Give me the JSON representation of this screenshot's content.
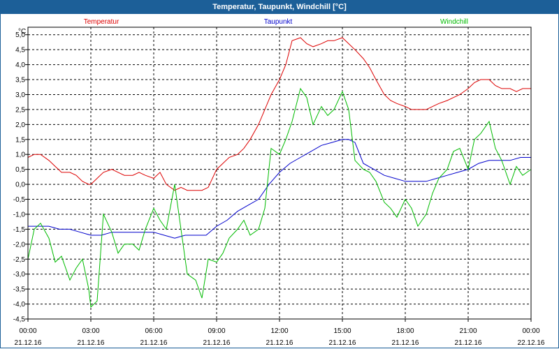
{
  "window": {
    "title": "Temperatur, Taupunkt, Windchill [°C]"
  },
  "chart_data": {
    "type": "line",
    "title": "Temperatur, Taupunkt, Windchill [°C]",
    "ylabel": "°C",
    "xlabel": "",
    "ylim": [
      -4.5,
      5.25
    ],
    "xlim_hours": [
      0,
      24
    ],
    "grid": true,
    "legend_position": "top",
    "y_ticks": [
      5.0,
      4.5,
      4.0,
      3.5,
      3.0,
      2.5,
      2.0,
      1.5,
      1.0,
      0.5,
      0.0,
      -0.5,
      -1.0,
      -1.5,
      -2.0,
      -2.5,
      -3.0,
      -3.5,
      -4.0,
      -4.5
    ],
    "y_tick_labels": [
      "5,0",
      "4,5",
      "4,0",
      "3,5",
      "3,0",
      "2,5",
      "2,0",
      "1,5",
      "1,0",
      "0,5",
      "0,0",
      "-0,5",
      "-1,0",
      "-1,5",
      "-2,0",
      "-2,5",
      "-3,0",
      "-3,5",
      "-4,0",
      "-4,5"
    ],
    "x_ticks": [
      {
        "hour": 0,
        "time": "00:00",
        "date": "21.12.16"
      },
      {
        "hour": 3,
        "time": "03:00",
        "date": "21.12.16"
      },
      {
        "hour": 6,
        "time": "06:00",
        "date": "21.12.16"
      },
      {
        "hour": 9,
        "time": "09:00",
        "date": "21.12.16"
      },
      {
        "hour": 12,
        "time": "12:00",
        "date": "21.12.16"
      },
      {
        "hour": 15,
        "time": "15:00",
        "date": "21.12.16"
      },
      {
        "hour": 18,
        "time": "18:00",
        "date": "21.12.16"
      },
      {
        "hour": 21,
        "time": "21:00",
        "date": "21.12.16"
      },
      {
        "hour": 24,
        "time": "00:00",
        "date": "22.12.16"
      }
    ],
    "series": [
      {
        "name": "Temperatur",
        "color": "#dd0000",
        "x": [
          0,
          0.3,
          0.6,
          1,
          1.3,
          1.6,
          2,
          2.3,
          2.6,
          2.9,
          3,
          3.3,
          3.6,
          4,
          4.3,
          4.6,
          5,
          5.3,
          5.6,
          6,
          6.3,
          6.6,
          7,
          7.3,
          7.6,
          8,
          8.3,
          8.6,
          9,
          9.3,
          9.6,
          10,
          10.3,
          10.6,
          11,
          11.3,
          11.6,
          12,
          12.3,
          12.6,
          13,
          13.3,
          13.6,
          14,
          14.3,
          14.6,
          15,
          15.3,
          15.6,
          16,
          16.3,
          16.6,
          17,
          17.3,
          17.6,
          18,
          18.3,
          18.6,
          19,
          19.3,
          19.6,
          20,
          20.3,
          20.6,
          21,
          21.3,
          21.6,
          22,
          22.3,
          22.6,
          23,
          23.3,
          23.6,
          24
        ],
        "y": [
          0.9,
          1.0,
          1.0,
          0.8,
          0.6,
          0.4,
          0.4,
          0.3,
          0.1,
          0.0,
          0.0,
          0.2,
          0.4,
          0.5,
          0.4,
          0.3,
          0.3,
          0.4,
          0.3,
          0.2,
          0.4,
          0.0,
          -0.2,
          -0.1,
          -0.2,
          -0.2,
          -0.2,
          -0.1,
          0.5,
          0.7,
          0.9,
          1.0,
          1.2,
          1.5,
          2.0,
          2.5,
          3.0,
          3.5,
          4.0,
          4.8,
          4.9,
          4.7,
          4.6,
          4.7,
          4.8,
          4.8,
          4.9,
          4.7,
          4.5,
          4.2,
          3.9,
          3.5,
          3.0,
          2.8,
          2.7,
          2.6,
          2.5,
          2.5,
          2.5,
          2.6,
          2.7,
          2.8,
          2.9,
          3.0,
          3.2,
          3.4,
          3.5,
          3.5,
          3.3,
          3.2,
          3.2,
          3.1,
          3.2,
          3.2
        ]
      },
      {
        "name": "Taupunkt",
        "color": "#0000cc",
        "x": [
          0,
          0.5,
          1,
          1.5,
          2,
          2.5,
          3,
          3.5,
          4,
          4.5,
          5,
          5.5,
          6,
          6.5,
          7,
          7.5,
          8,
          8.5,
          9,
          9.5,
          10,
          10.5,
          11,
          11.5,
          12,
          12.5,
          13,
          13.5,
          14,
          14.5,
          15,
          15.3,
          15.6,
          16,
          16.5,
          17,
          17.5,
          18,
          18.5,
          19,
          19.5,
          20,
          20.5,
          21,
          21.5,
          22,
          22.5,
          23,
          23.5,
          24
        ],
        "y": [
          -1.4,
          -1.4,
          -1.4,
          -1.5,
          -1.5,
          -1.6,
          -1.7,
          -1.7,
          -1.6,
          -1.6,
          -1.6,
          -1.6,
          -1.6,
          -1.7,
          -1.8,
          -1.7,
          -1.7,
          -1.7,
          -1.4,
          -1.2,
          -0.9,
          -0.7,
          -0.5,
          0.0,
          0.4,
          0.7,
          0.9,
          1.1,
          1.3,
          1.4,
          1.5,
          1.5,
          1.4,
          0.7,
          0.5,
          0.3,
          0.2,
          0.1,
          0.1,
          0.1,
          0.2,
          0.3,
          0.4,
          0.5,
          0.7,
          0.8,
          0.8,
          0.8,
          0.9,
          0.9
        ]
      },
      {
        "name": "Windchill",
        "color": "#00bb00",
        "x": [
          0,
          0.3,
          0.6,
          1,
          1.3,
          1.6,
          2,
          2.3,
          2.6,
          2.9,
          3,
          3.3,
          3.6,
          4,
          4.3,
          4.6,
          5,
          5.3,
          5.6,
          6,
          6.3,
          6.6,
          7,
          7.3,
          7.6,
          8,
          8.3,
          8.6,
          9,
          9.3,
          9.6,
          10,
          10.3,
          10.6,
          11,
          11.3,
          11.6,
          12,
          12.3,
          12.6,
          13,
          13.3,
          13.6,
          14,
          14.3,
          14.6,
          15,
          15.3,
          15.6,
          16,
          16.3,
          16.6,
          17,
          17.3,
          17.6,
          18,
          18.3,
          18.6,
          19,
          19.3,
          19.6,
          20,
          20.3,
          20.6,
          21,
          21.3,
          21.6,
          22,
          22.3,
          22.6,
          23,
          23.3,
          23.6,
          24
        ],
        "y": [
          -2.5,
          -1.5,
          -1.3,
          -1.8,
          -2.6,
          -2.4,
          -3.2,
          -2.8,
          -2.5,
          -3.5,
          -4.1,
          -3.9,
          -1.0,
          -1.6,
          -2.3,
          -2.0,
          -2.0,
          -2.2,
          -1.5,
          -0.8,
          -1.2,
          -1.5,
          0.0,
          -1.5,
          -3.0,
          -3.2,
          -3.8,
          -2.5,
          -2.6,
          -2.3,
          -1.8,
          -1.5,
          -1.2,
          -1.7,
          -1.5,
          -0.8,
          1.2,
          1.0,
          1.5,
          2.1,
          3.2,
          2.9,
          2.0,
          2.6,
          2.3,
          2.5,
          3.1,
          2.5,
          0.8,
          0.5,
          0.4,
          0.1,
          -0.6,
          -0.8,
          -1.1,
          -0.5,
          -0.8,
          -1.4,
          -1.0,
          -0.3,
          0.2,
          0.5,
          1.1,
          1.2,
          0.5,
          1.5,
          1.7,
          2.1,
          1.2,
          0.8,
          0.0,
          0.6,
          0.3,
          0.5
        ]
      }
    ]
  }
}
